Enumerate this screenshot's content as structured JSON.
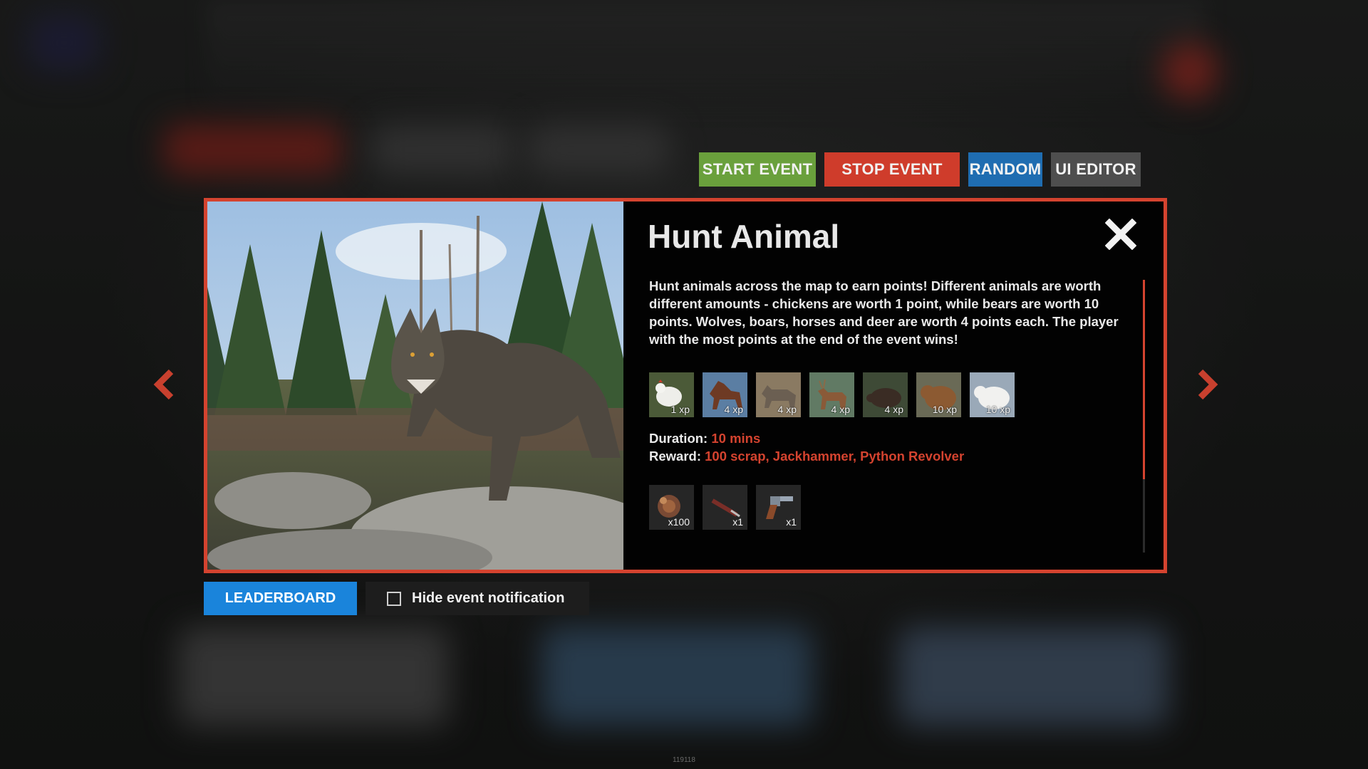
{
  "actions": {
    "start": "START EVENT",
    "stop": "STOP EVENT",
    "random": "RANDOM",
    "ui_editor": "UI EDITOR"
  },
  "event": {
    "title": "Hunt Animal",
    "description": "Hunt animals across the map to earn points! Different animals are worth different amounts - chickens are worth 1 point, while bears are worth 10 points. Wolves, boars, horses and deer are worth 4 points each. The player with the most points at the end of the event wins!",
    "animals": [
      {
        "icon": "chicken-icon",
        "label": "1 xp"
      },
      {
        "icon": "horse-icon",
        "label": "4 xp"
      },
      {
        "icon": "wolf-icon",
        "label": "4 xp"
      },
      {
        "icon": "deer-icon",
        "label": "4 xp"
      },
      {
        "icon": "boar-icon",
        "label": "4 xp"
      },
      {
        "icon": "bear-icon",
        "label": "10 xp"
      },
      {
        "icon": "polar-bear-icon",
        "label": "10 xp"
      }
    ],
    "duration_label": "Duration:",
    "duration_value": "10 mins",
    "reward_label": "Reward:",
    "reward_value": "100 scrap, Jackhammer, Python Revolver",
    "rewards": [
      {
        "icon": "scrap-icon",
        "label": "x100"
      },
      {
        "icon": "jackhammer-icon",
        "label": "x1"
      },
      {
        "icon": "python-revolver-icon",
        "label": "x1"
      }
    ]
  },
  "bottom": {
    "leaderboard": "LEADERBOARD",
    "hide_notification": "Hide event notification"
  },
  "version": "119118",
  "colors": {
    "accent": "#d4432f",
    "start": "#6aa03c",
    "random": "#1f6db1",
    "leaderboard": "#1a84db"
  }
}
